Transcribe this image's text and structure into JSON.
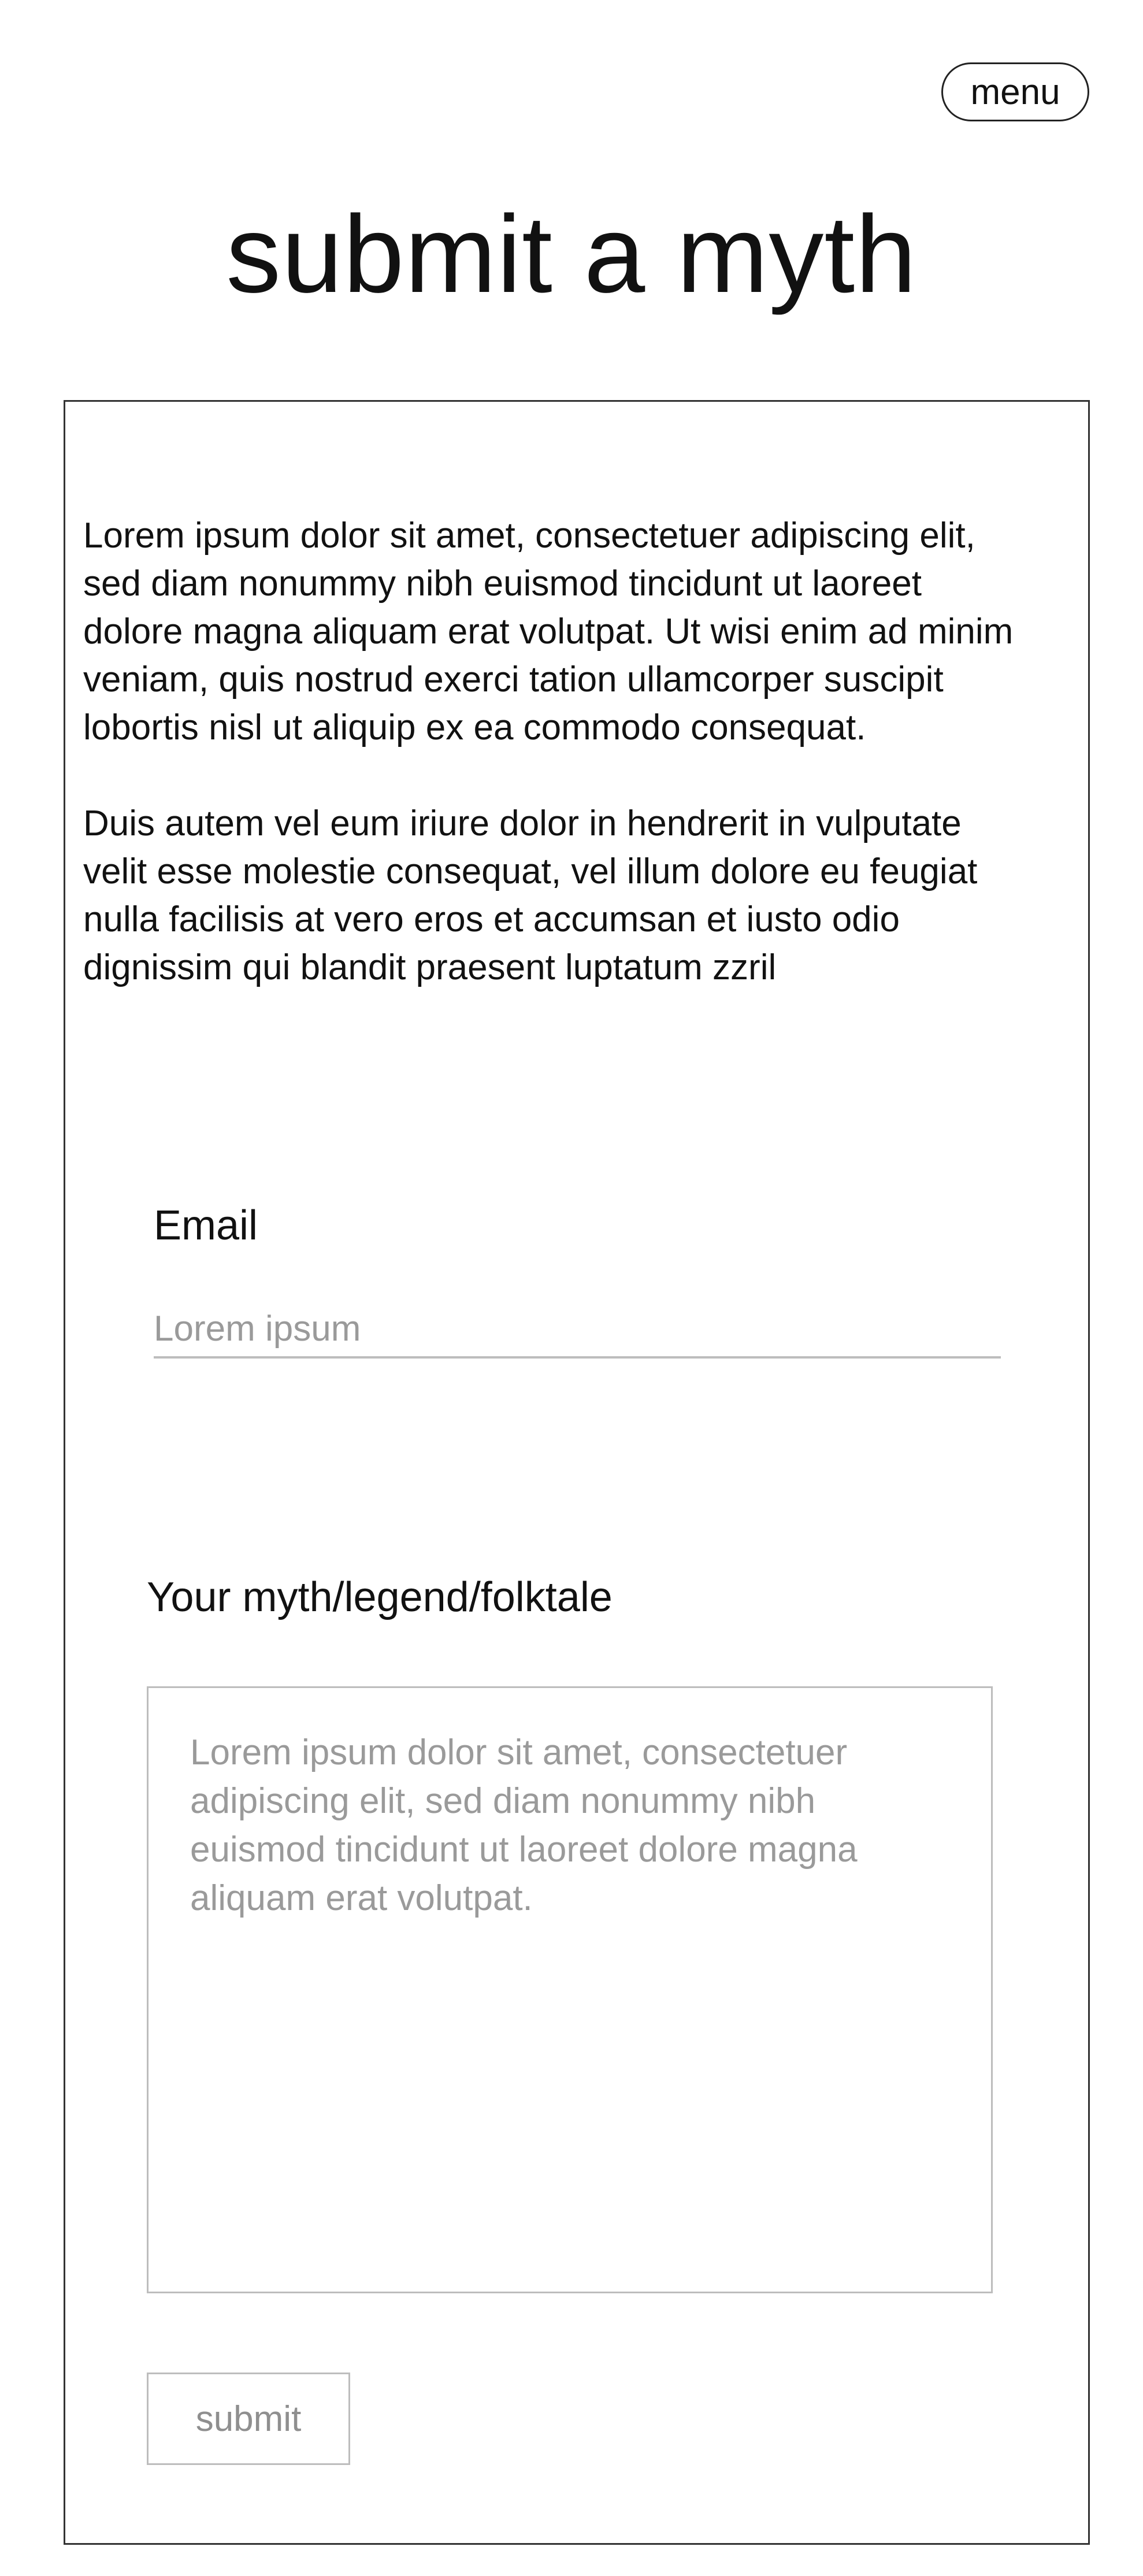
{
  "header": {
    "menu_label": "menu",
    "page_title": "submit a myth"
  },
  "intro": {
    "paragraph_1": "Lorem ipsum dolor sit amet, consectetuer adipiscing elit, sed diam nonummy nibh euismod tincidunt ut laoreet dolore magna aliquam erat volutpat. Ut wisi enim ad minim veniam, quis nostrud exerci tation ullamcorper suscipit lobortis nisl ut aliquip ex ea commodo consequat.",
    "paragraph_2": "Duis autem vel eum iriure dolor in hendrerit in vulputate velit esse molestie consequat, vel illum dolore eu feugiat nulla facilisis at vero eros et accumsan et iusto odio dignissim qui blandit praesent luptatum zzril"
  },
  "form": {
    "email_label": "Email",
    "email_placeholder": "Lorem ipsum",
    "email_value": "",
    "myth_label": "Your myth/legend/folktale",
    "myth_placeholder": "Lorem ipsum dolor sit amet, consectetuer adipiscing elit, sed diam nonummy nibh euismod tincidunt ut laoreet dolore magna aliquam erat volutpat.",
    "myth_value": "",
    "submit_label": "submit"
  }
}
